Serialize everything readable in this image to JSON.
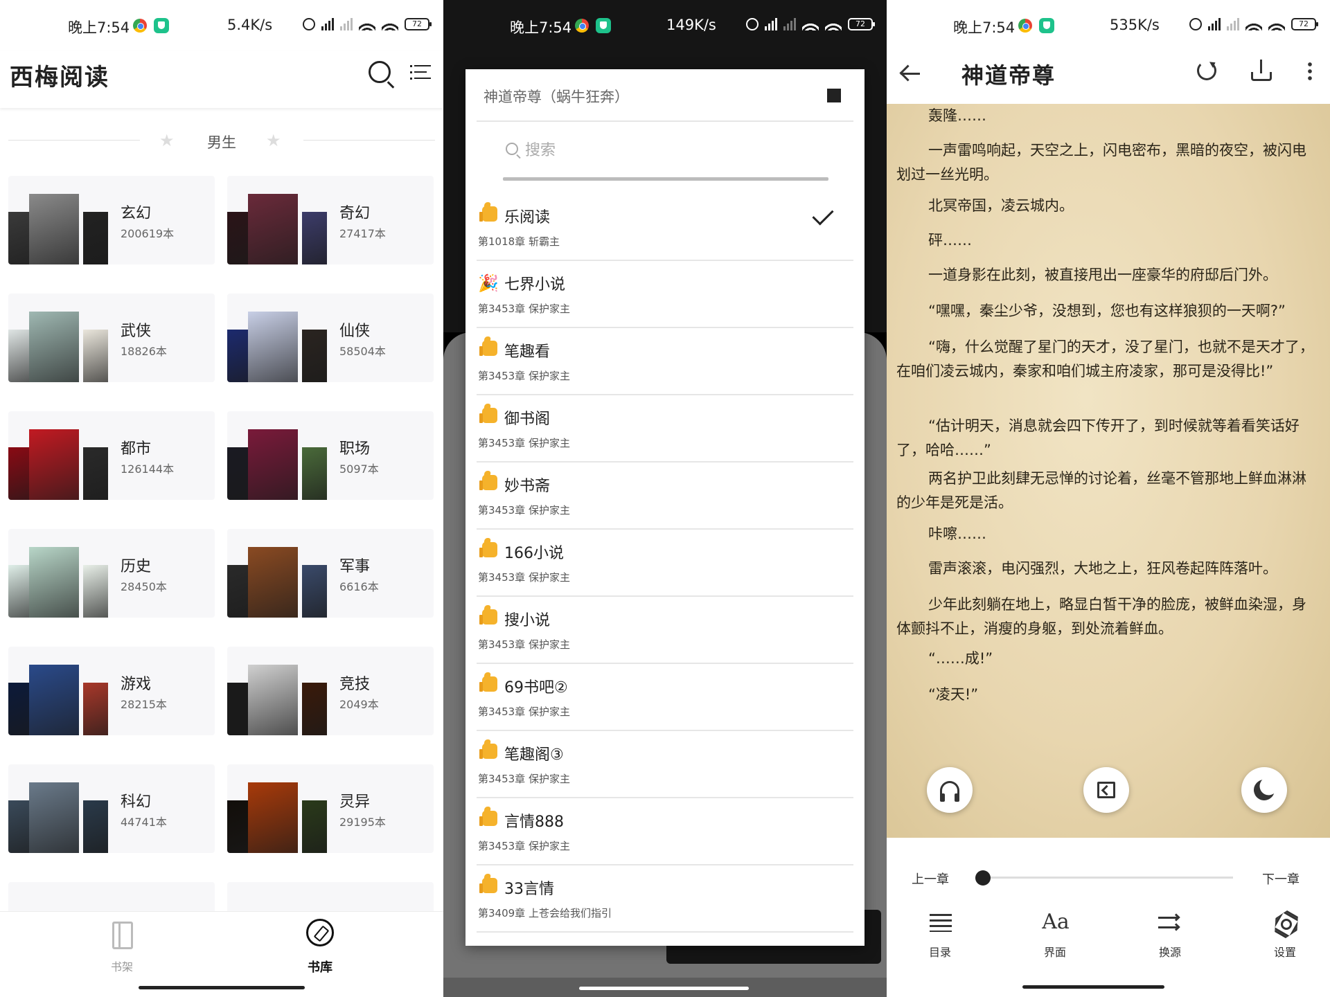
{
  "status": {
    "time": "晚上7:54",
    "speed_library": "5.4K/s",
    "speed_source": "149K/s",
    "speed_reader": "535K/s",
    "battery": "72"
  },
  "library": {
    "app_title": "西梅阅读",
    "section": "男生",
    "categories": [
      {
        "name": "玄幻",
        "count": "200619本",
        "colors": [
          "#3a3a3a",
          "#8a8a8a",
          "#222222"
        ]
      },
      {
        "name": "奇幻",
        "count": "27417本",
        "colors": [
          "#2b1418",
          "#6a2a3a",
          "#3c3c6a"
        ]
      },
      {
        "name": "武侠",
        "count": "18826本",
        "colors": [
          "#dfe5e4",
          "#9fb8b2",
          "#eae6dc"
        ]
      },
      {
        "name": "仙侠",
        "count": "58504本",
        "colors": [
          "#1c2a6e",
          "#c8cfe6",
          "#2a2420"
        ]
      },
      {
        "name": "都市",
        "count": "126144本",
        "colors": [
          "#8a0a14",
          "#c21a22",
          "#2a2a2a"
        ]
      },
      {
        "name": "职场",
        "count": "5097本",
        "colors": [
          "#1a1a22",
          "#7a1a3a",
          "#4a6a3a"
        ]
      },
      {
        "name": "历史",
        "count": "28450本",
        "colors": [
          "#dfeee8",
          "#b8d6c8",
          "#e8efe8"
        ]
      },
      {
        "name": "军事",
        "count": "6616本",
        "colors": [
          "#2a2a2a",
          "#8a4a22",
          "#3a4a6a"
        ]
      },
      {
        "name": "游戏",
        "count": "28215本",
        "colors": [
          "#0c1a3a",
          "#2a4a8a",
          "#a8382a"
        ]
      },
      {
        "name": "竞技",
        "count": "2049本",
        "colors": [
          "#1a1a1a",
          "#d0d0d0",
          "#3a1a0a"
        ]
      },
      {
        "name": "科幻",
        "count": "44741本",
        "colors": [
          "#3a4a5a",
          "#6a7a8a",
          "#2a3a4a"
        ]
      },
      {
        "name": "灵异",
        "count": "29195本",
        "colors": [
          "#120e0a",
          "#a83a0a",
          "#2a3a1a"
        ]
      }
    ],
    "nav": [
      {
        "label": "书架",
        "active": false
      },
      {
        "label": "书库",
        "active": true
      }
    ]
  },
  "source_dialog": {
    "title": "神道帝尊（蜗牛狂奔）",
    "search_placeholder": "搜索",
    "items": [
      {
        "icon": "thumbs-up",
        "name": "乐阅读",
        "chapter": "第1018章 斩霸主",
        "selected": true
      },
      {
        "icon": "party-popper",
        "name": "七界小说",
        "chapter": "第3453章 保护家主",
        "selected": false
      },
      {
        "icon": "thumbs-up",
        "name": "笔趣看",
        "chapter": "第3453章 保护家主",
        "selected": false
      },
      {
        "icon": "thumbs-up",
        "name": "御书阁",
        "chapter": "第3453章 保护家主",
        "selected": false
      },
      {
        "icon": "thumbs-up",
        "name": "妙书斋",
        "chapter": "第3453章 保护家主",
        "selected": false
      },
      {
        "icon": "thumbs-up",
        "name": "166小说",
        "chapter": "第3453章 保护家主",
        "selected": false
      },
      {
        "icon": "thumbs-up",
        "name": "搜小说",
        "chapter": "第3453章 保护家主",
        "selected": false
      },
      {
        "icon": "thumbs-up",
        "name": "69书吧②",
        "chapter": "第3453章 保护家主",
        "selected": false
      },
      {
        "icon": "thumbs-up",
        "name": "笔趣阁③",
        "chapter": "第3453章 保护家主",
        "selected": false
      },
      {
        "icon": "thumbs-up",
        "name": "言情888",
        "chapter": "第3453章 保护家主",
        "selected": false
      },
      {
        "icon": "thumbs-up",
        "name": "33言情",
        "chapter": "第3409章 上苍会给我们指引",
        "selected": false
      }
    ]
  },
  "reader": {
    "book_title": "神道帝尊",
    "paragraphs": [
      "轰隆……",
      "一声雷鸣响起，天空之上，闪电密布，黑暗的夜空，被闪电划过一丝光明。",
      "北冥帝国，凌云城内。",
      "砰……",
      "一道身影在此刻，被直接甩出一座豪华的府邸后门外。",
      "“嘿嘿，秦尘少爷，没想到，您也有这样狼狈的一天啊?”",
      "“嗨，什么觉醒了星门的天才，没了星门，也就不是天才了，在咱们凌云城内，秦家和咱们城主府凌家，那可是没得比!”",
      "“估计明天，消息就会四下传开了，到时候就等着看笑话好了，哈哈……”",
      "两名护卫此刻肆无忌惮的讨论着，丝毫不管那地上鲜血淋淋的少年是死是活。",
      "咔嚓……",
      "雷声滚滚，电闪强烈，大地之上，狂风卷起阵阵落叶。",
      "少年此刻躺在地上，略显白皙干净的脸庞，被鲜血染湿，身体颤抖不止，消瘦的身躯，到处流着鲜血。",
      "“……成!”",
      "“凌天!”"
    ],
    "prev_chapter": "上一章",
    "next_chapter": "下一章",
    "progress": 0,
    "tools": [
      {
        "label": "目录",
        "icon": "toc-icon"
      },
      {
        "label": "界面",
        "icon": "font-aa-icon"
      },
      {
        "label": "换源",
        "icon": "swap-source-icon"
      },
      {
        "label": "设置",
        "icon": "gear-icon"
      }
    ]
  }
}
